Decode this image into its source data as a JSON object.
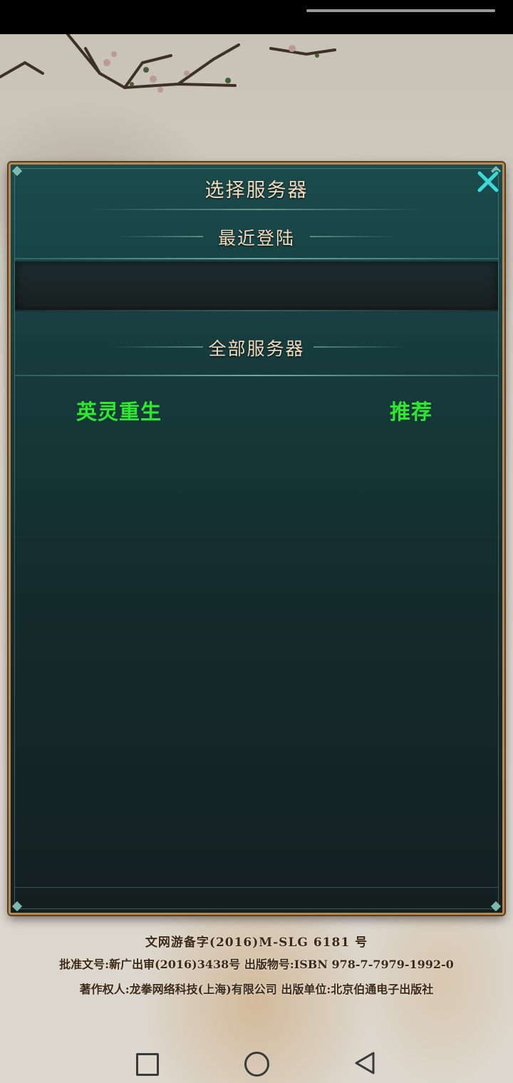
{
  "dialog": {
    "title": "选择服务器",
    "close_icon": "close-x-icon",
    "recent_section_label": "最近登陆",
    "all_servers_section_label": "全部服务器",
    "servers": [
      {
        "name": "英灵重生",
        "tag": "推荐"
      }
    ]
  },
  "legal": {
    "line1": "文网游备字(2016)M-SLG 6181 号",
    "line2": "批准文号:新广出审(2016)3438号  出版物号:ISBN 978-7-7979-1992-0",
    "line3": "著作权人:龙拳网络科技(上海)有限公司     出版单位:北京伯通电子出版社"
  },
  "nav": {
    "recents_icon": "square-recents-icon",
    "home_icon": "circle-home-icon",
    "back_icon": "triangle-back-icon"
  },
  "colors": {
    "server_text": "#2ee82e",
    "header_text": "#f0dcc0",
    "frame_gold": "#b48a52",
    "close_cyan": "#3fd6d6"
  }
}
